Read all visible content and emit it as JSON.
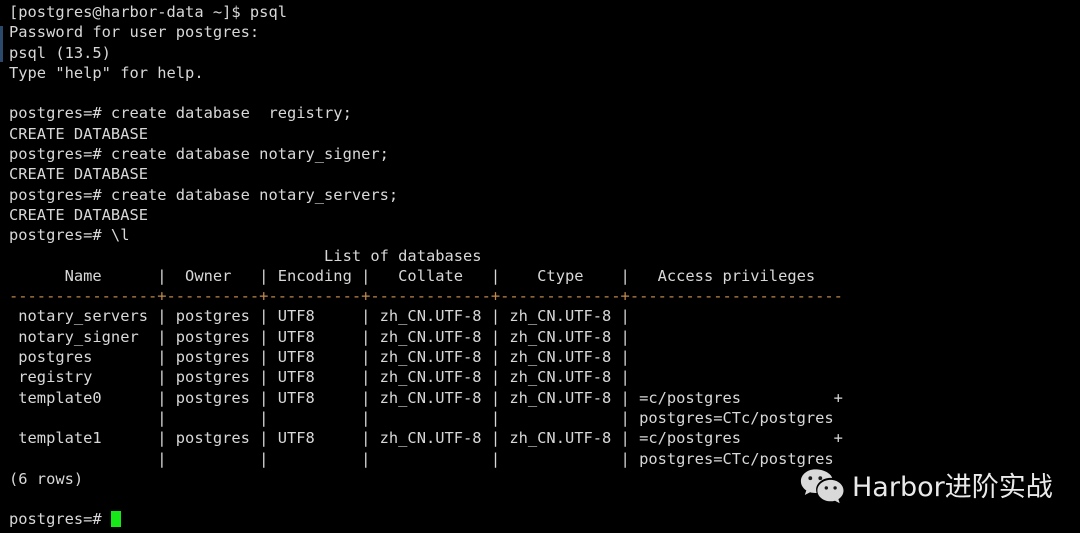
{
  "terminal": {
    "background_color": "#000000",
    "text_color": "#d8d8d8",
    "border_color": "#c08a4a",
    "cursor_color": "#17e817",
    "lines": [
      {
        "id": "shell-prompt-psql",
        "text": "[postgres@harbor-data ~]$ psql",
        "kind": "text"
      },
      {
        "id": "password-prompt",
        "text": "Password for user postgres:",
        "kind": "text"
      },
      {
        "id": "psql-version",
        "text": "psql (13.5)",
        "kind": "text"
      },
      {
        "id": "help-hint",
        "text": "Type \"help\" for help.",
        "kind": "text"
      },
      {
        "id": "blank-1",
        "text": "",
        "kind": "blank"
      },
      {
        "id": "cmd-create-registry",
        "text": "postgres=# create database  registry;",
        "kind": "text"
      },
      {
        "id": "out-create-1",
        "text": "CREATE DATABASE",
        "kind": "text"
      },
      {
        "id": "cmd-create-signer",
        "text": "postgres=# create database notary_signer;",
        "kind": "text"
      },
      {
        "id": "out-create-2",
        "text": "CREATE DATABASE",
        "kind": "text"
      },
      {
        "id": "cmd-create-servers",
        "text": "postgres=# create database notary_servers;",
        "kind": "text"
      },
      {
        "id": "out-create-3",
        "text": "CREATE DATABASE",
        "kind": "text"
      },
      {
        "id": "cmd-list-databases",
        "text": "postgres=# \\l",
        "kind": "text"
      },
      {
        "id": "table-title",
        "text": "                                  List of databases",
        "kind": "text"
      },
      {
        "id": "table-header",
        "text": "      Name      |  Owner   | Encoding |   Collate   |    Ctype    |   Access privileges",
        "kind": "text"
      },
      {
        "id": "table-separator",
        "text": "----------------+----------+----------+-------------+-------------+-----------------------",
        "kind": "border"
      },
      {
        "id": "row-notary-servers",
        "text": " notary_servers | postgres | UTF8     | zh_CN.UTF-8 | zh_CN.UTF-8 |",
        "kind": "text"
      },
      {
        "id": "row-notary-signer",
        "text": " notary_signer  | postgres | UTF8     | zh_CN.UTF-8 | zh_CN.UTF-8 |",
        "kind": "text"
      },
      {
        "id": "row-postgres",
        "text": " postgres       | postgres | UTF8     | zh_CN.UTF-8 | zh_CN.UTF-8 |",
        "kind": "text"
      },
      {
        "id": "row-registry",
        "text": " registry       | postgres | UTF8     | zh_CN.UTF-8 | zh_CN.UTF-8 |",
        "kind": "text"
      },
      {
        "id": "row-template0",
        "text": " template0      | postgres | UTF8     | zh_CN.UTF-8 | zh_CN.UTF-8 | =c/postgres          +",
        "kind": "text"
      },
      {
        "id": "row-template0-cont",
        "text": "                |          |          |             |             | postgres=CTc/postgres",
        "kind": "text"
      },
      {
        "id": "row-template1",
        "text": " template1      | postgres | UTF8     | zh_CN.UTF-8 | zh_CN.UTF-8 | =c/postgres          +",
        "kind": "text"
      },
      {
        "id": "row-template1-cont",
        "text": "                |          |          |             |             | postgres=CTc/postgres",
        "kind": "text"
      },
      {
        "id": "row-count",
        "text": "(6 rows)",
        "kind": "text"
      },
      {
        "id": "blank-2",
        "text": "",
        "kind": "blank"
      },
      {
        "id": "final-prompt",
        "text": "postgres=# ",
        "kind": "prompt-cursor"
      }
    ]
  },
  "table": {
    "title": "List of databases",
    "columns": [
      "Name",
      "Owner",
      "Encoding",
      "Collate",
      "Ctype",
      "Access privileges"
    ],
    "rows": [
      {
        "name": "notary_servers",
        "owner": "postgres",
        "encoding": "UTF8",
        "collate": "zh_CN.UTF-8",
        "ctype": "zh_CN.UTF-8",
        "access_privileges": ""
      },
      {
        "name": "notary_signer",
        "owner": "postgres",
        "encoding": "UTF8",
        "collate": "zh_CN.UTF-8",
        "ctype": "zh_CN.UTF-8",
        "access_privileges": ""
      },
      {
        "name": "postgres",
        "owner": "postgres",
        "encoding": "UTF8",
        "collate": "zh_CN.UTF-8",
        "ctype": "zh_CN.UTF-8",
        "access_privileges": ""
      },
      {
        "name": "registry",
        "owner": "postgres",
        "encoding": "UTF8",
        "collate": "zh_CN.UTF-8",
        "ctype": "zh_CN.UTF-8",
        "access_privileges": ""
      },
      {
        "name": "template0",
        "owner": "postgres",
        "encoding": "UTF8",
        "collate": "zh_CN.UTF-8",
        "ctype": "zh_CN.UTF-8",
        "access_privileges": "=c/postgres +postgres=CTc/postgres"
      },
      {
        "name": "template1",
        "owner": "postgres",
        "encoding": "UTF8",
        "collate": "zh_CN.UTF-8",
        "ctype": "zh_CN.UTF-8",
        "access_privileges": "=c/postgres +postgres=CTc/postgres"
      }
    ],
    "row_count_label": "(6 rows)"
  },
  "watermark": {
    "icon": "wechat-icon",
    "text": "Harbor进阶实战",
    "color": "#eaeaea"
  }
}
